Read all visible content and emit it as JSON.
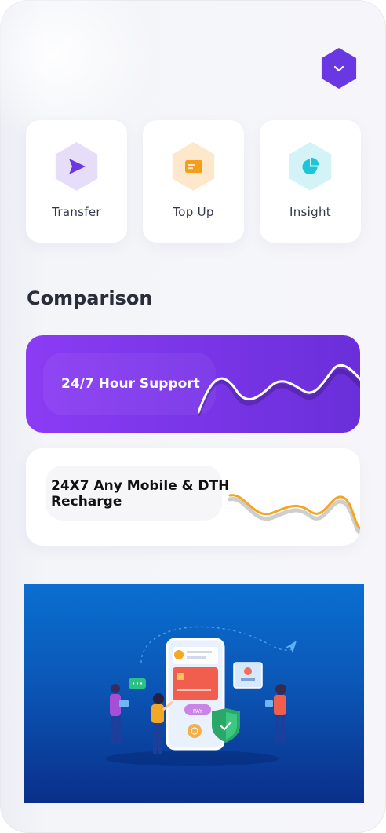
{
  "header": {
    "menu_icon": "chevron-down-icon",
    "accent": "#6a38e3"
  },
  "actions": [
    {
      "label": "Transfer",
      "icon": "send-icon",
      "color": "#6a38e3"
    },
    {
      "label": "Top Up",
      "icon": "card-icon",
      "color": "#f59e1b"
    },
    {
      "label": "Insight",
      "icon": "pie-chart-icon",
      "color": "#1cc6d8"
    }
  ],
  "section": {
    "title": "Comparison"
  },
  "comparisons": [
    {
      "title": "24/7 Hour Support",
      "background": "#7a35e8"
    },
    {
      "title": "24X7 Any Mobile & DTH Recharge",
      "wave_color": "#f5a623"
    }
  ],
  "promo": {
    "pay_label": "PAY",
    "illustration": "mobile-payment-illustration"
  }
}
